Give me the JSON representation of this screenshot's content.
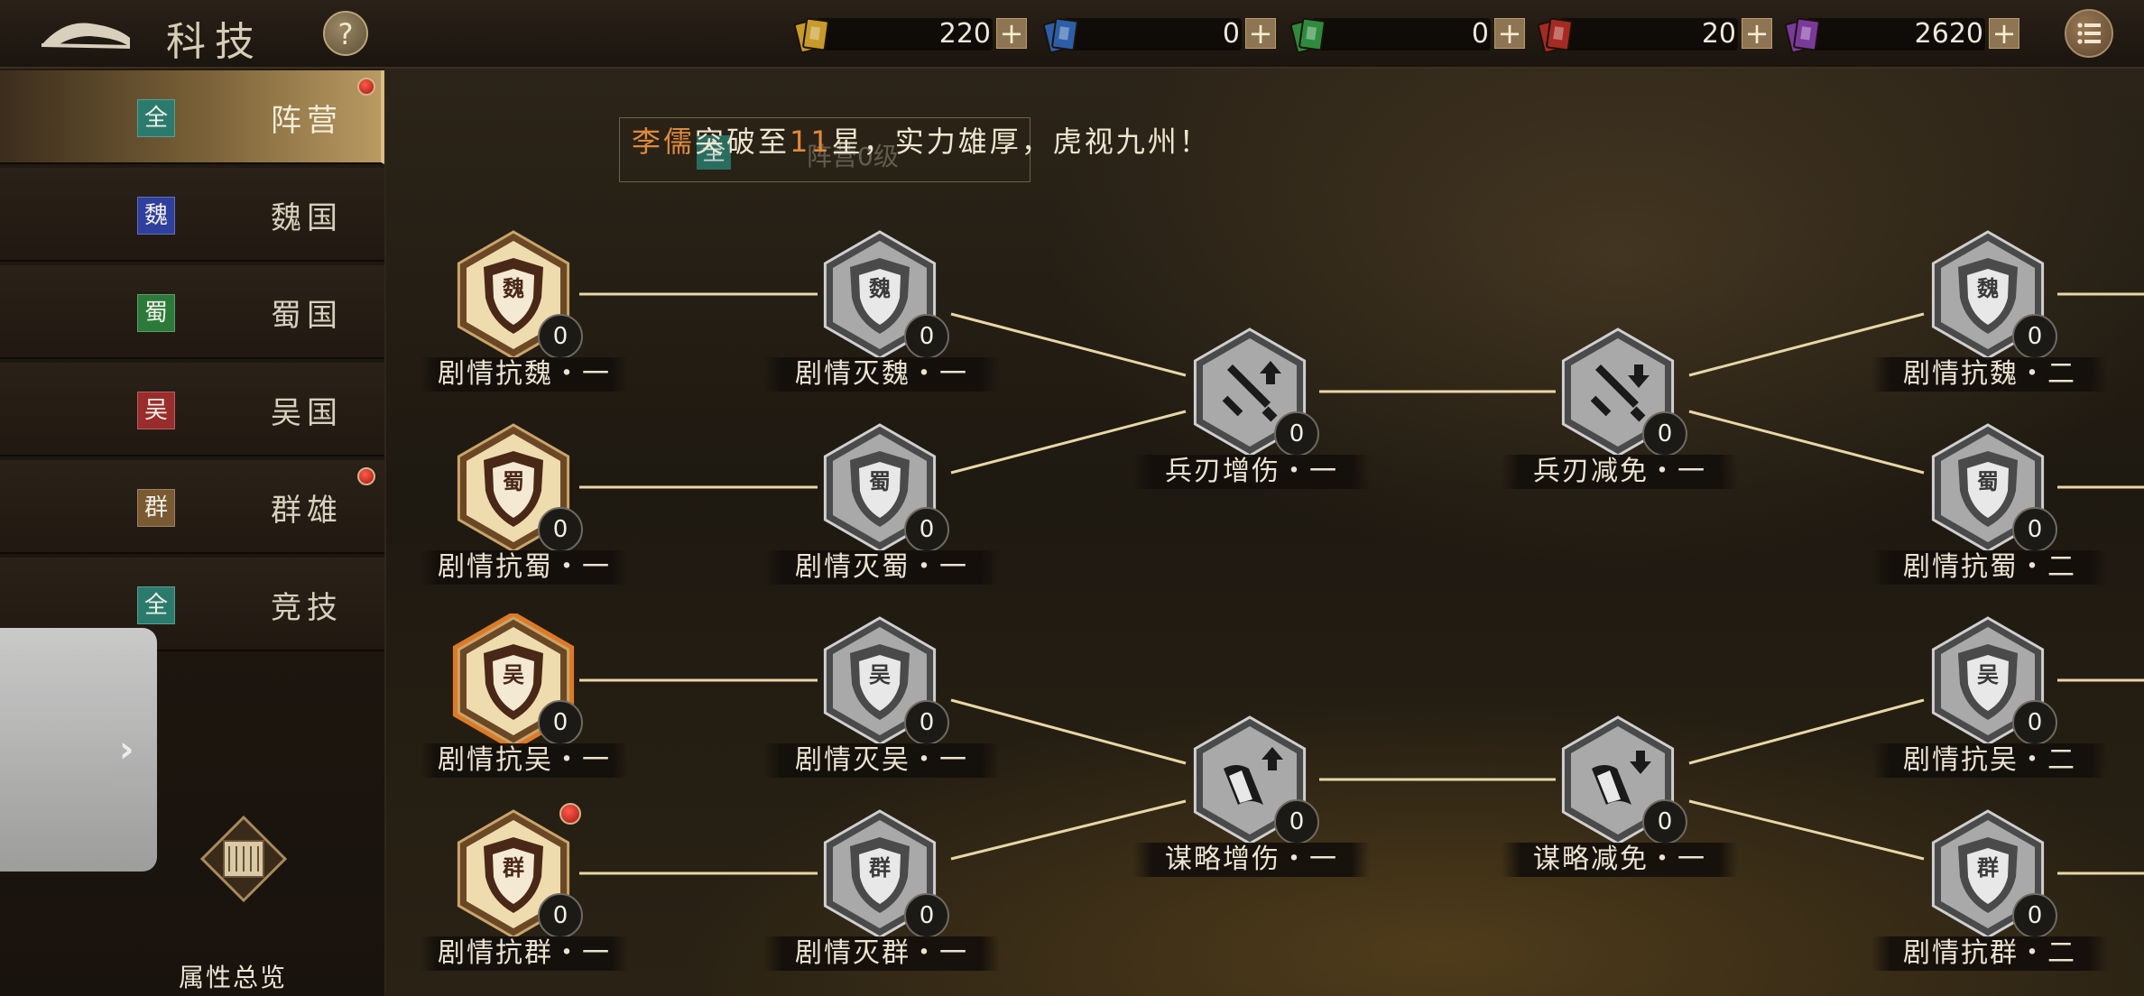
{
  "header": {
    "title": "科技",
    "help_label": "?",
    "resources": [
      {
        "name": "yellow-token",
        "color": "#c79a2a",
        "value": "220",
        "plus": "+"
      },
      {
        "name": "blue-token",
        "color": "#2d5ea8",
        "value": "0",
        "plus": "+"
      },
      {
        "name": "green-token",
        "color": "#2f8a3d",
        "value": "0",
        "plus": "+"
      },
      {
        "name": "red-token",
        "color": "#a52a22",
        "value": "20",
        "plus": "+"
      },
      {
        "name": "purple-token",
        "color": "#7a3a9c",
        "value": "2620",
        "plus": "+"
      }
    ]
  },
  "sidebar": {
    "tabs": [
      {
        "badge": "全",
        "label": "阵营",
        "badge_color": "#2a7b6d",
        "active": true,
        "red_dot": true
      },
      {
        "badge": "魏",
        "label": "魏国",
        "badge_color": "#2f3f9e",
        "active": false,
        "red_dot": false
      },
      {
        "badge": "蜀",
        "label": "蜀国",
        "badge_color": "#2b7a3a",
        "active": false,
        "red_dot": false
      },
      {
        "badge": "吴",
        "label": "吴国",
        "badge_color": "#9a2c2c",
        "active": false,
        "red_dot": false
      },
      {
        "badge": "群",
        "label": "群雄",
        "badge_color": "#7a5a32",
        "active": false,
        "red_dot": true
      },
      {
        "badge": "全",
        "label": "竞技",
        "badge_color": "#2a7b6d",
        "active": false,
        "red_dot": false
      }
    ],
    "overview_label": "属性总览",
    "handle_arrow": "›"
  },
  "notice": {
    "name": "李儒",
    "text_a": "突破至",
    "level": "11",
    "text_b": "星，实力雄厚，虎视九州！",
    "ghost_badge": "全",
    "ghost_text": "阵营0级"
  },
  "tree": {
    "nodes": [
      {
        "id": "r1c1",
        "style": "gold",
        "glyph": "魏",
        "count": "0",
        "label": "剧情抗魏・一",
        "red_dot": false
      },
      {
        "id": "r2c1",
        "style": "gold",
        "glyph": "蜀",
        "count": "0",
        "label": "剧情抗蜀・一",
        "red_dot": false
      },
      {
        "id": "r3c1",
        "style": "gold-glow",
        "glyph": "吴",
        "count": "0",
        "label": "剧情抗吴・一",
        "red_dot": false
      },
      {
        "id": "r4c1",
        "style": "gold",
        "glyph": "群",
        "count": "0",
        "label": "剧情抗群・一",
        "red_dot": true
      },
      {
        "id": "r1c2",
        "style": "silver",
        "glyph": "魏",
        "count": "0",
        "label": "剧情灭魏・一",
        "red_dot": false
      },
      {
        "id": "r2c2",
        "style": "silver",
        "glyph": "蜀",
        "count": "0",
        "label": "剧情灭蜀・一",
        "red_dot": false
      },
      {
        "id": "r3c2",
        "style": "silver",
        "glyph": "吴",
        "count": "0",
        "label": "剧情灭吴・一",
        "red_dot": false
      },
      {
        "id": "r4c2",
        "style": "silver",
        "glyph": "群",
        "count": "0",
        "label": "剧情灭群・一",
        "red_dot": false
      },
      {
        "id": "m1",
        "style": "silver",
        "glyph": "sword-up",
        "count": "0",
        "label": "兵刃增伤・一",
        "red_dot": false
      },
      {
        "id": "m2",
        "style": "silver",
        "glyph": "sword-down",
        "count": "0",
        "label": "兵刃减免・一",
        "red_dot": false
      },
      {
        "id": "m3",
        "style": "silver",
        "glyph": "scroll-up",
        "count": "0",
        "label": "谋略增伤・一",
        "red_dot": false
      },
      {
        "id": "m4",
        "style": "silver",
        "glyph": "scroll-down",
        "count": "0",
        "label": "谋略减免・一",
        "red_dot": false
      },
      {
        "id": "r1c3",
        "style": "silver",
        "glyph": "魏",
        "count": "0",
        "label": "剧情抗魏・二",
        "red_dot": false
      },
      {
        "id": "r2c3",
        "style": "silver",
        "glyph": "蜀",
        "count": "0",
        "label": "剧情抗蜀・二",
        "red_dot": false
      },
      {
        "id": "r3c3",
        "style": "silver",
        "glyph": "吴",
        "count": "0",
        "label": "剧情抗吴・二",
        "red_dot": false
      },
      {
        "id": "r4c3",
        "style": "silver",
        "glyph": "群",
        "count": "0",
        "label": "剧情抗群・二",
        "red_dot": false
      }
    ]
  }
}
